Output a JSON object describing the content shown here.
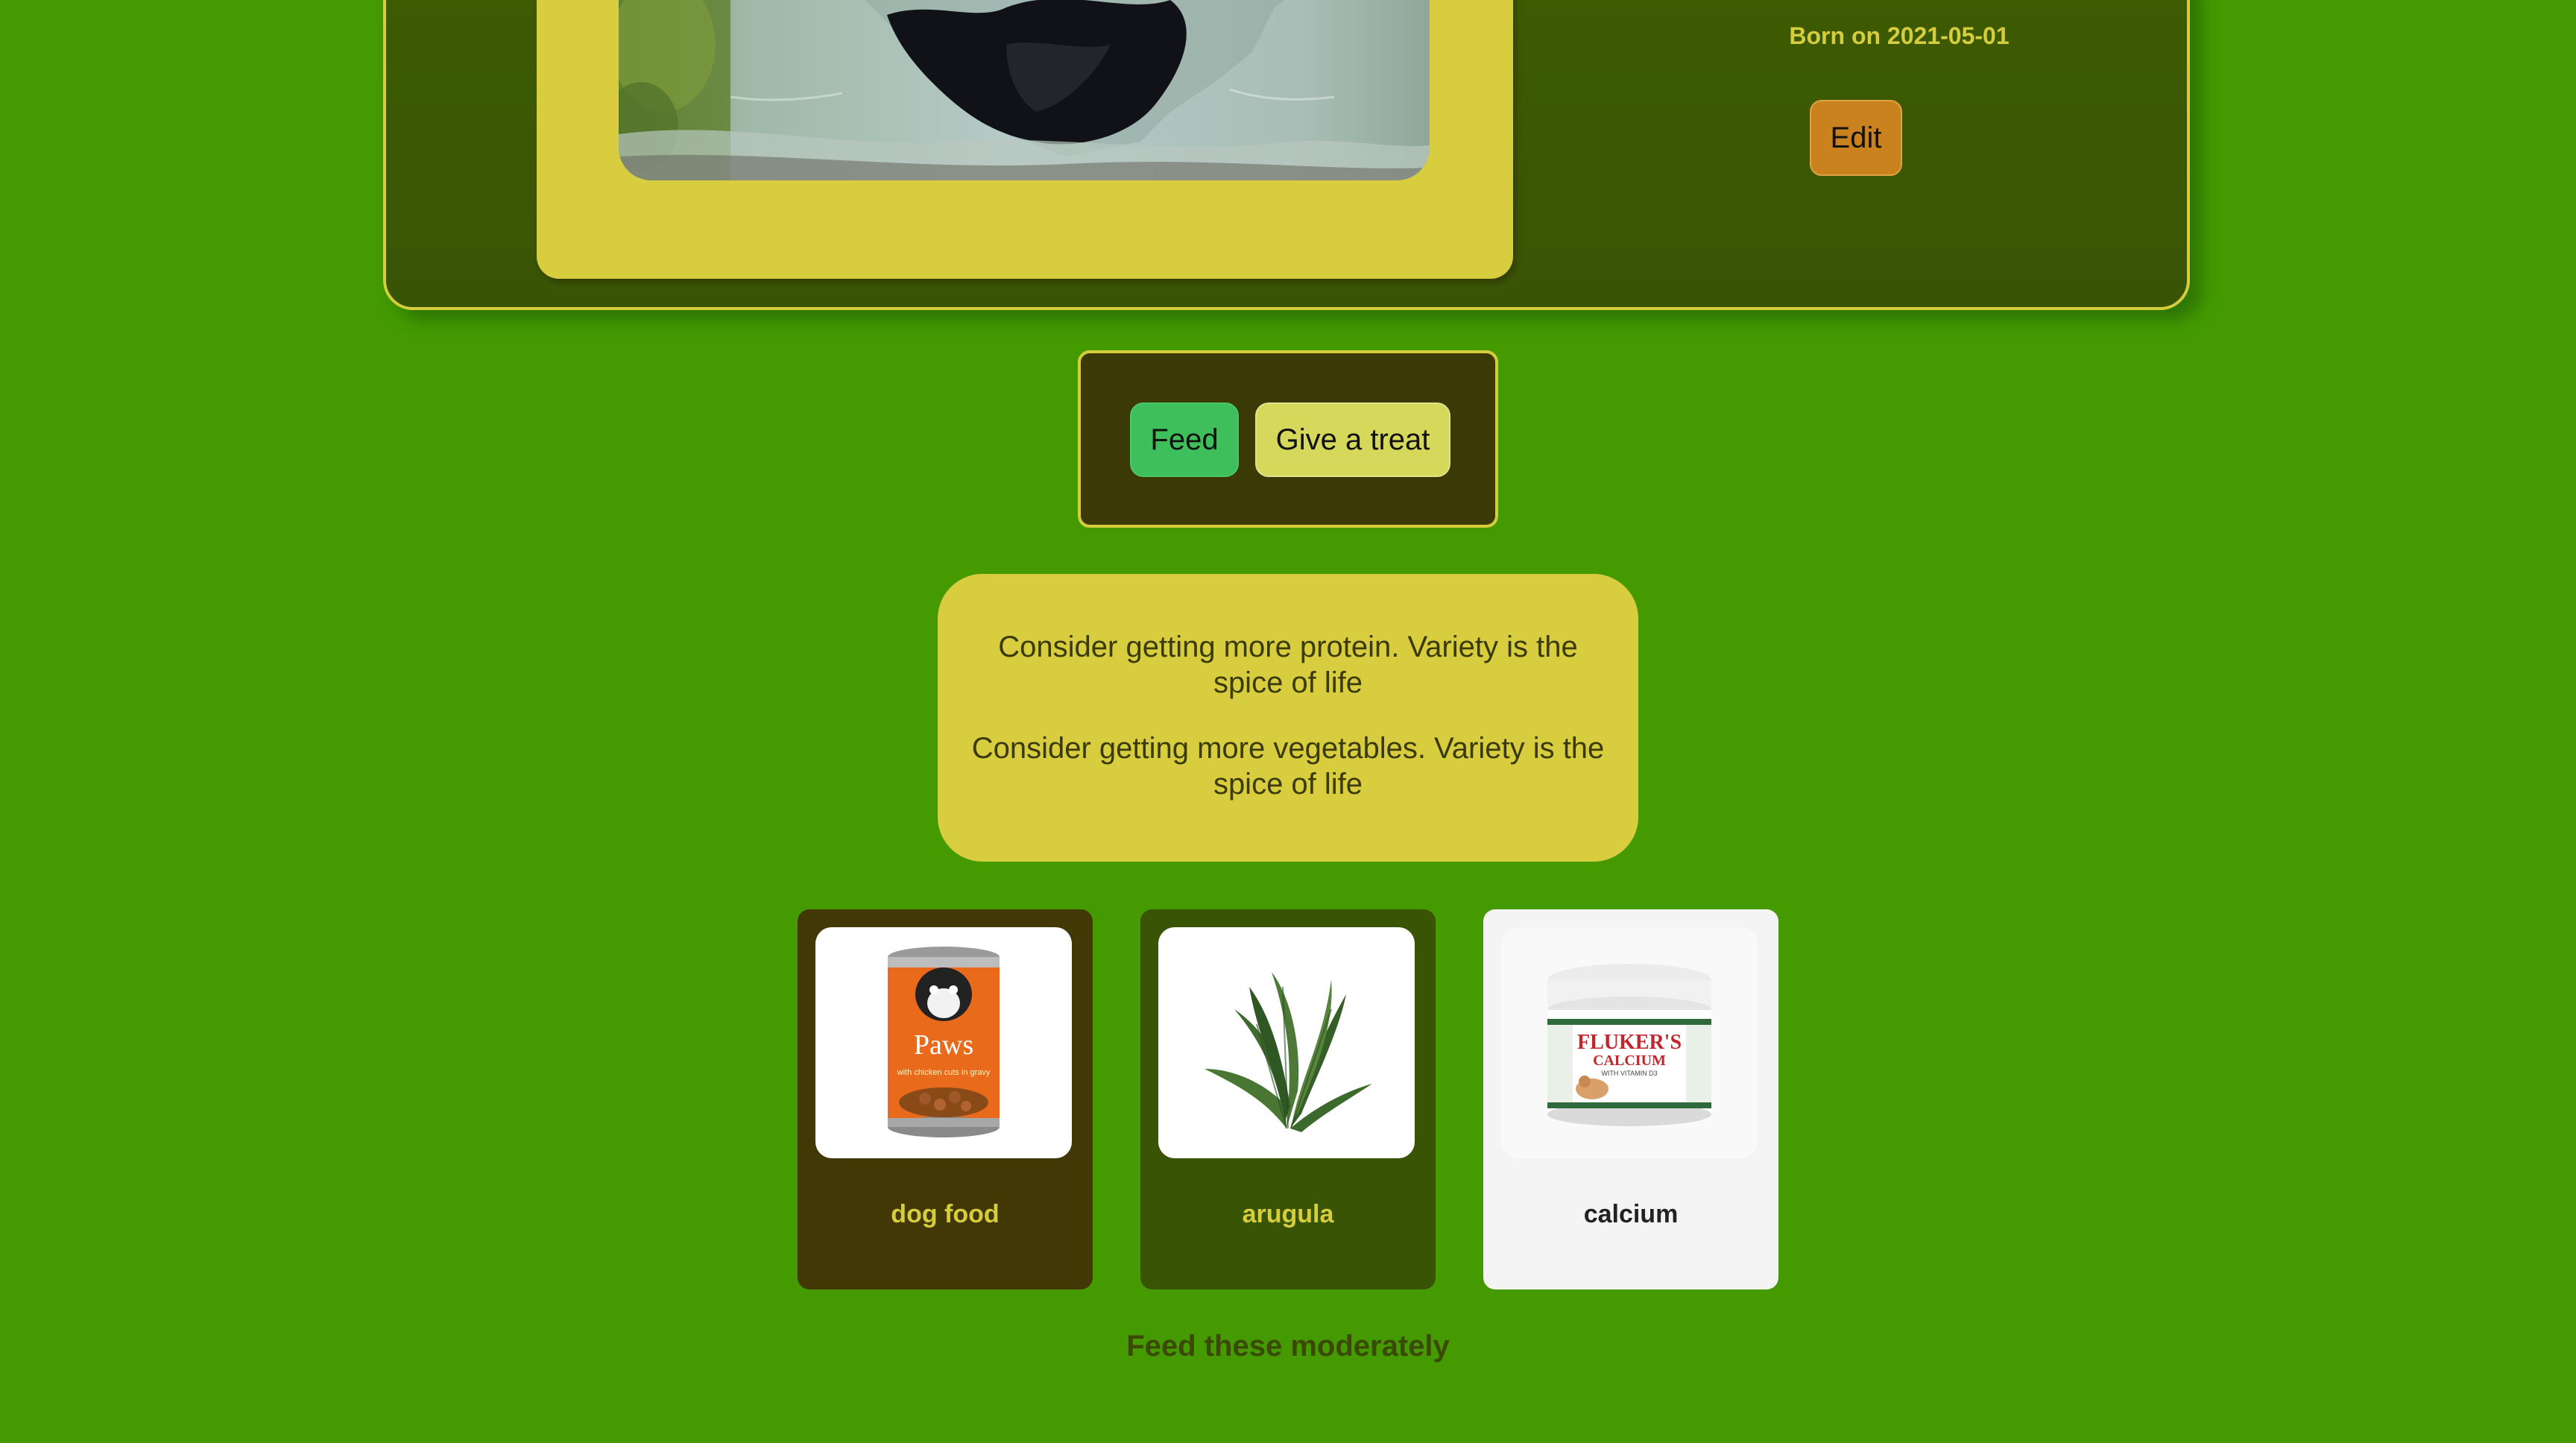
{
  "profile": {
    "born_text": "Born on 2021-05-01",
    "edit_label": "Edit"
  },
  "actions": {
    "feed_label": "Feed",
    "treat_label": "Give a treat"
  },
  "suggestions": [
    "Consider getting more protein. Variety is the spice of life",
    "Consider getting more vegetables. Variety is the spice of life"
  ],
  "foods": [
    {
      "label": "dog food"
    },
    {
      "label": "arugula"
    },
    {
      "label": "calcium"
    }
  ],
  "food_images": {
    "dog_food": {
      "brand": "Paws",
      "tagline": "with chicken cuts in gravy"
    },
    "calcium": {
      "brand": "FLUKER'S",
      "product": "CALCIUM",
      "sub": "WITH VITAMIN D3"
    }
  },
  "moderate_text": "Feed these moderately",
  "colors": {
    "background": "#449a00",
    "accent_yellow": "#d6cd3d",
    "dark_olive": "#3e5c02",
    "feed_green": "#3fbf5b",
    "edit_orange": "#c9821e"
  }
}
